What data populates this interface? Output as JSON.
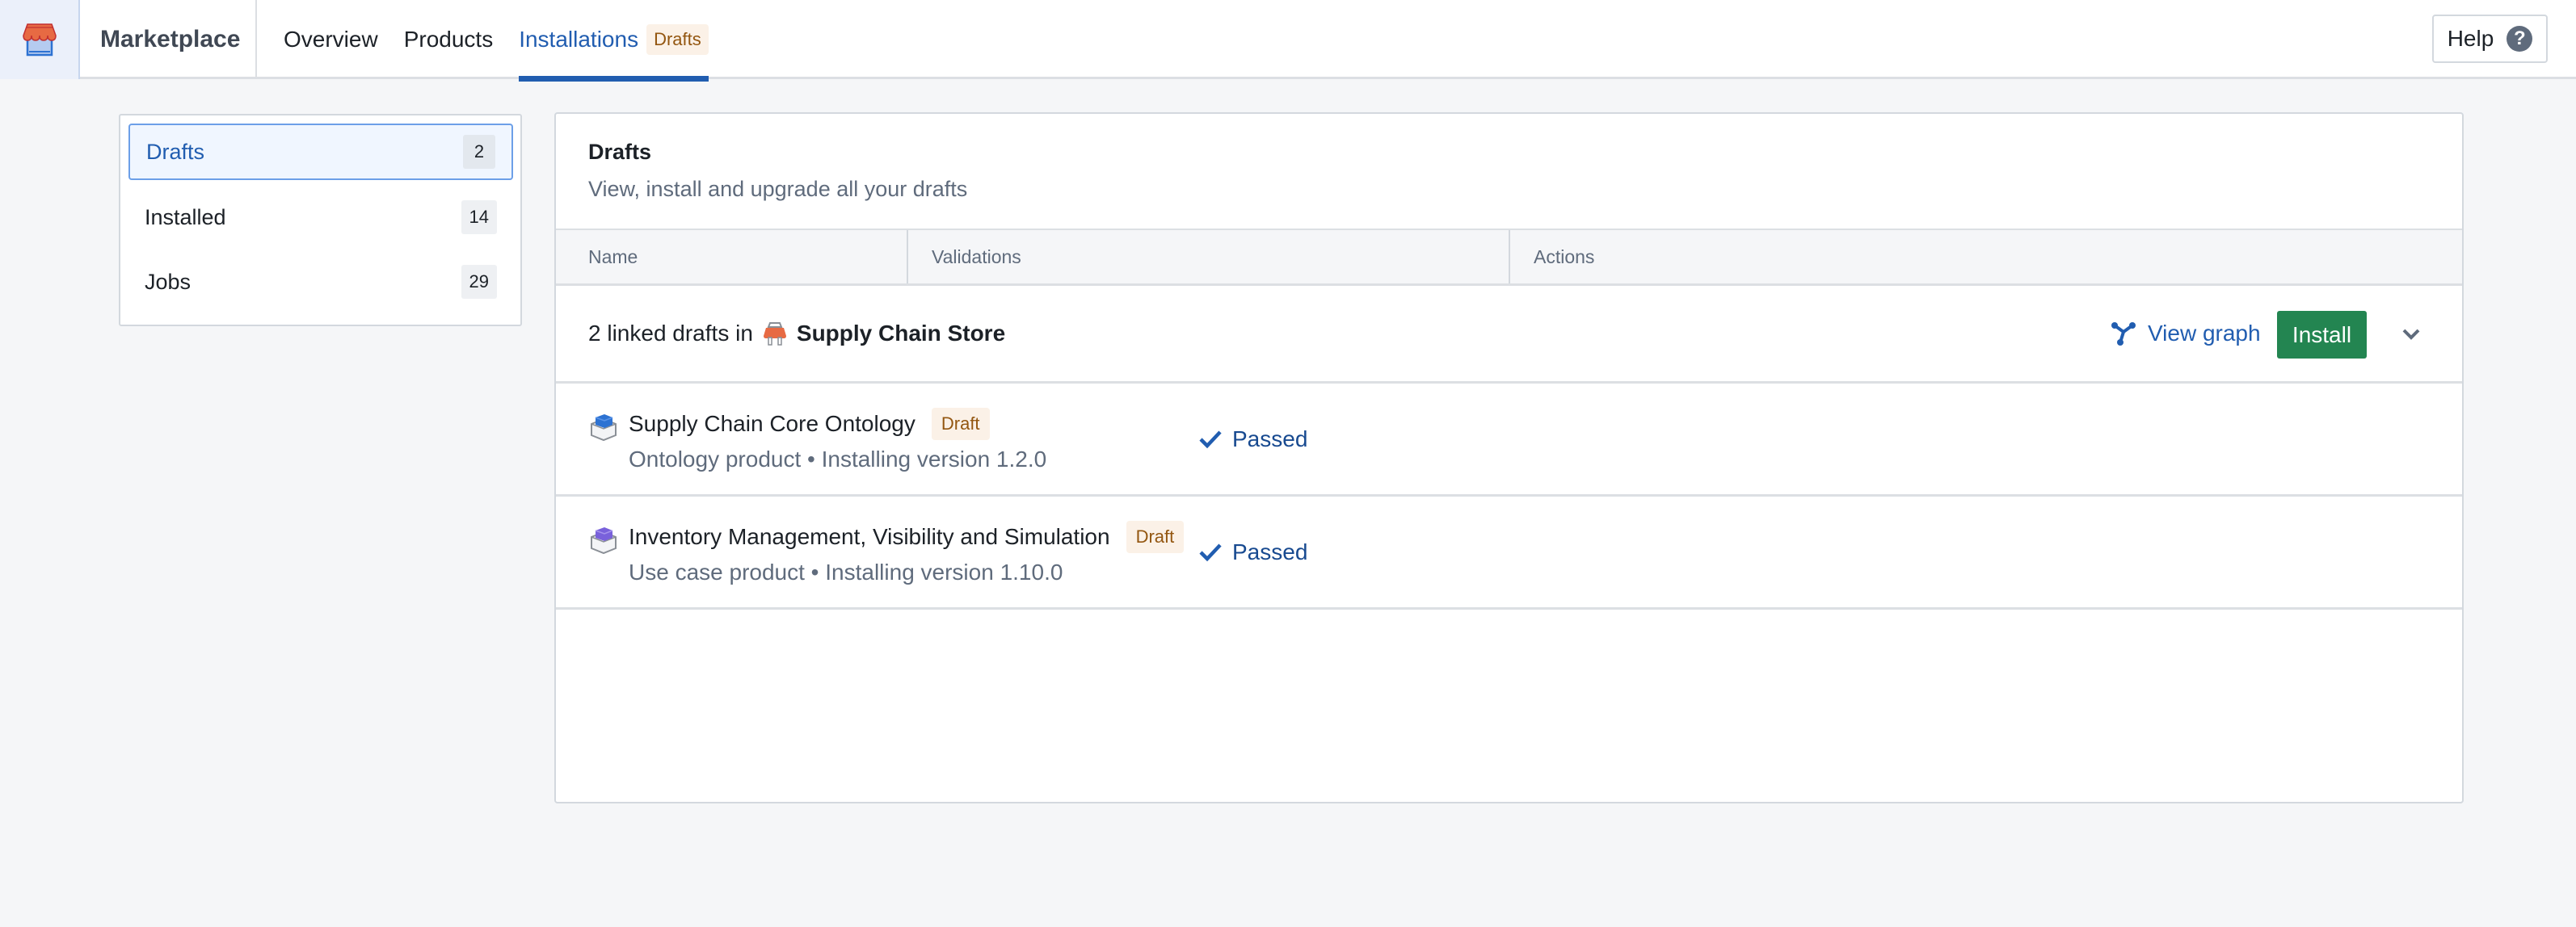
{
  "header": {
    "app_title": "Marketplace",
    "nav": [
      {
        "label": "Overview",
        "active": false
      },
      {
        "label": "Products",
        "active": false
      },
      {
        "label": "Installations",
        "active": true,
        "badge": "Drafts"
      }
    ],
    "help_label": "Help",
    "help_icon_glyph": "?"
  },
  "sidebar": {
    "items": [
      {
        "label": "Drafts",
        "count": "2",
        "active": true
      },
      {
        "label": "Installed",
        "count": "14",
        "active": false
      },
      {
        "label": "Jobs",
        "count": "29",
        "active": false
      }
    ]
  },
  "main": {
    "title": "Drafts",
    "subtitle": "View, install and upgrade all your drafts",
    "columns": [
      "Name",
      "Validations",
      "Actions"
    ],
    "group": {
      "prefix": "2 linked drafts in",
      "store_name": "Supply Chain Store",
      "view_graph_label": "View graph",
      "install_label": "Install"
    },
    "drafts": [
      {
        "name": "Supply Chain Core Ontology",
        "tag": "Draft",
        "meta": "Ontology product • Installing version 1.2.0",
        "validation": "Passed",
        "icon_color": "#2d72d2"
      },
      {
        "name": "Inventory Management, Visibility and Simulation",
        "tag": "Draft",
        "meta": "Use case product • Installing version 1.10.0",
        "validation": "Passed",
        "icon_color": "#7961db"
      }
    ]
  },
  "colors": {
    "accent": "#215db0",
    "install_button": "#238551",
    "draft_tag_bg": "#fbf1e7",
    "draft_tag_text": "#935610",
    "store_icon": "#e76a43"
  }
}
